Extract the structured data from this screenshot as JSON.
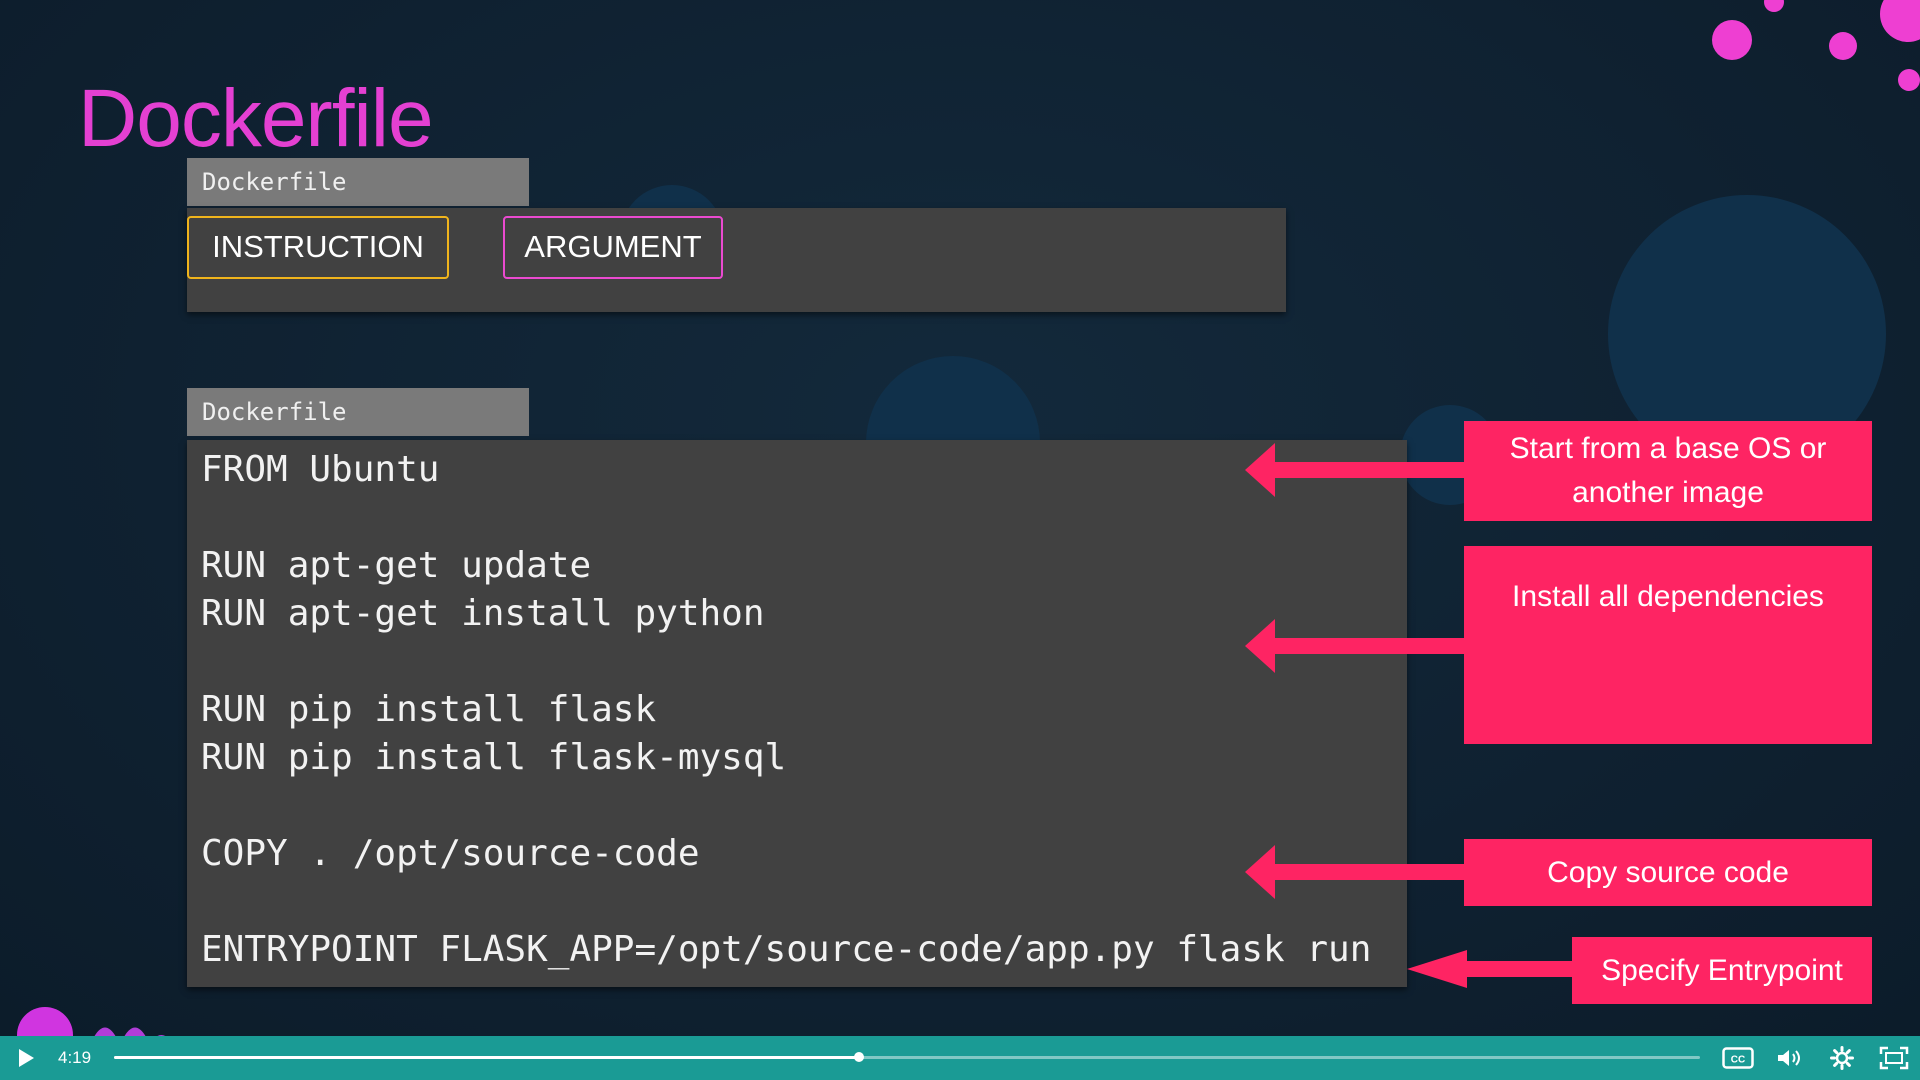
{
  "slide": {
    "title": "Dockerfile",
    "syntax_box": {
      "tab_label": "Dockerfile",
      "instruction_label": "INSTRUCTION",
      "argument_label": "ARGUMENT"
    },
    "code_box": {
      "tab_label": "Dockerfile",
      "lines": [
        "FROM Ubuntu",
        "RUN apt-get update",
        "RUN apt-get install python",
        "RUN pip install flask",
        "RUN pip install flask-mysql",
        "COPY . /opt/source-code",
        "ENTRYPOINT FLASK_APP=/opt/source-code/app.py flask run"
      ]
    },
    "callouts": [
      "Start from a base OS or another image",
      "Install all dependencies",
      "Copy source code",
      "Specify Entrypoint"
    ],
    "colors": {
      "title": "#e440d2",
      "callout": "#fe2463",
      "instruction_border": "#f0b41c",
      "argument_border": "#ea4ad0"
    }
  },
  "player": {
    "current_time": "4:19",
    "progress": 0.47,
    "icons": [
      "play-icon",
      "captions-icon",
      "volume-icon",
      "settings-icon",
      "fullscreen-icon"
    ],
    "accent": "#1a9b95"
  }
}
